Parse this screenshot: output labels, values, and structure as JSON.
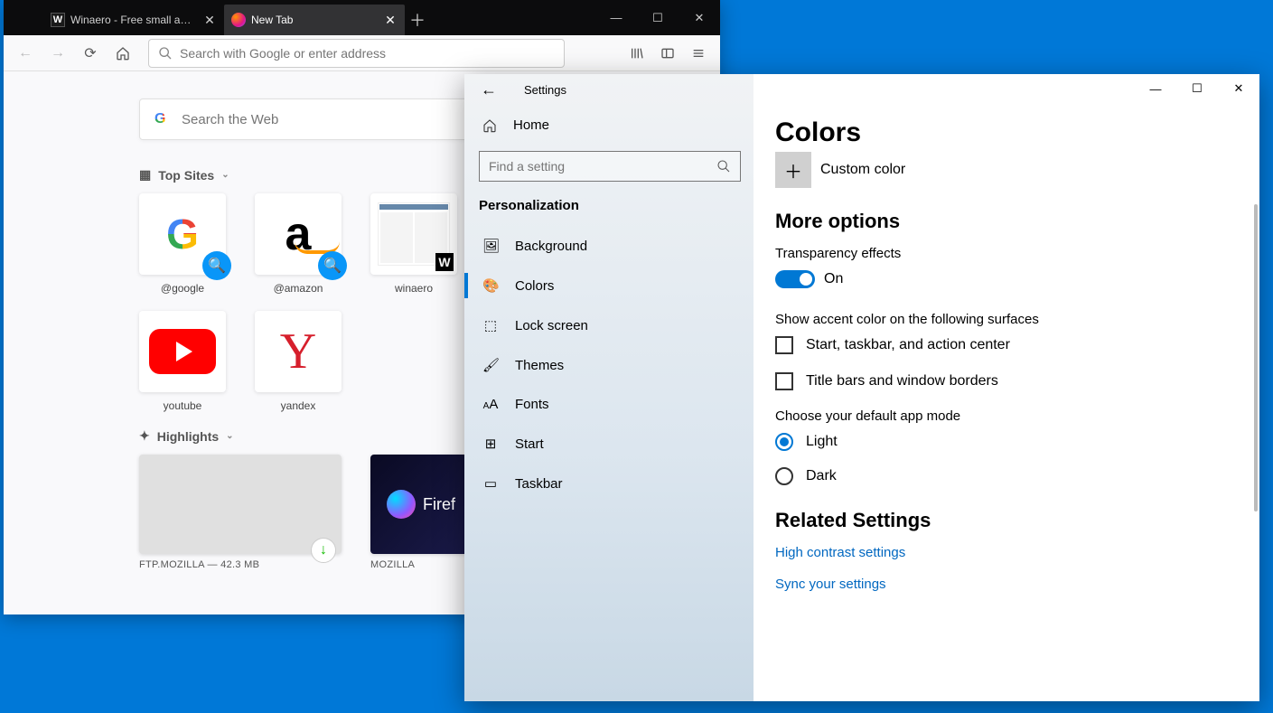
{
  "firefox": {
    "tabs": [
      {
        "title": "Winaero - Free small and usefu",
        "favicon": "W"
      },
      {
        "title": "New Tab",
        "favicon": "firefox"
      }
    ],
    "urlbar_placeholder": "Search with Google or enter address",
    "search_placeholder": "Search the Web",
    "top_sites_label": "Top Sites",
    "tiles": [
      {
        "label": "@google",
        "kind": "google",
        "pinned": true
      },
      {
        "label": "@amazon",
        "kind": "amazon",
        "pinned": true
      },
      {
        "label": "winaero",
        "kind": "winaero",
        "pinned": false
      },
      {
        "label": "youtube",
        "kind": "youtube",
        "pinned": false
      },
      {
        "label": "yandex",
        "kind": "yandex",
        "pinned": false
      }
    ],
    "highlights_label": "Highlights",
    "highlights": [
      {
        "title": "FTP.MOZILLA — 42.3 MB",
        "kind": "download"
      },
      {
        "title": "MOZILLA",
        "kind": "nightly",
        "brand": "Firef"
      }
    ]
  },
  "settings": {
    "title": "Settings",
    "home_label": "Home",
    "search_placeholder": "Find a setting",
    "category": "Personalization",
    "items": [
      {
        "label": "Background"
      },
      {
        "label": "Colors"
      },
      {
        "label": "Lock screen"
      },
      {
        "label": "Themes"
      },
      {
        "label": "Fonts"
      },
      {
        "label": "Start"
      },
      {
        "label": "Taskbar"
      }
    ],
    "page_title": "Colors",
    "custom_color_label": "Custom color",
    "more_options_label": "More options",
    "transparency_label": "Transparency effects",
    "transparency_state": "On",
    "accent_surfaces_label": "Show accent color on the following surfaces",
    "checkbox1": "Start, taskbar, and action center",
    "checkbox2": "Title bars and window borders",
    "app_mode_label": "Choose your default app mode",
    "radio_light": "Light",
    "radio_dark": "Dark",
    "related_label": "Related Settings",
    "link1": "High contrast settings",
    "link2": "Sync your settings"
  }
}
